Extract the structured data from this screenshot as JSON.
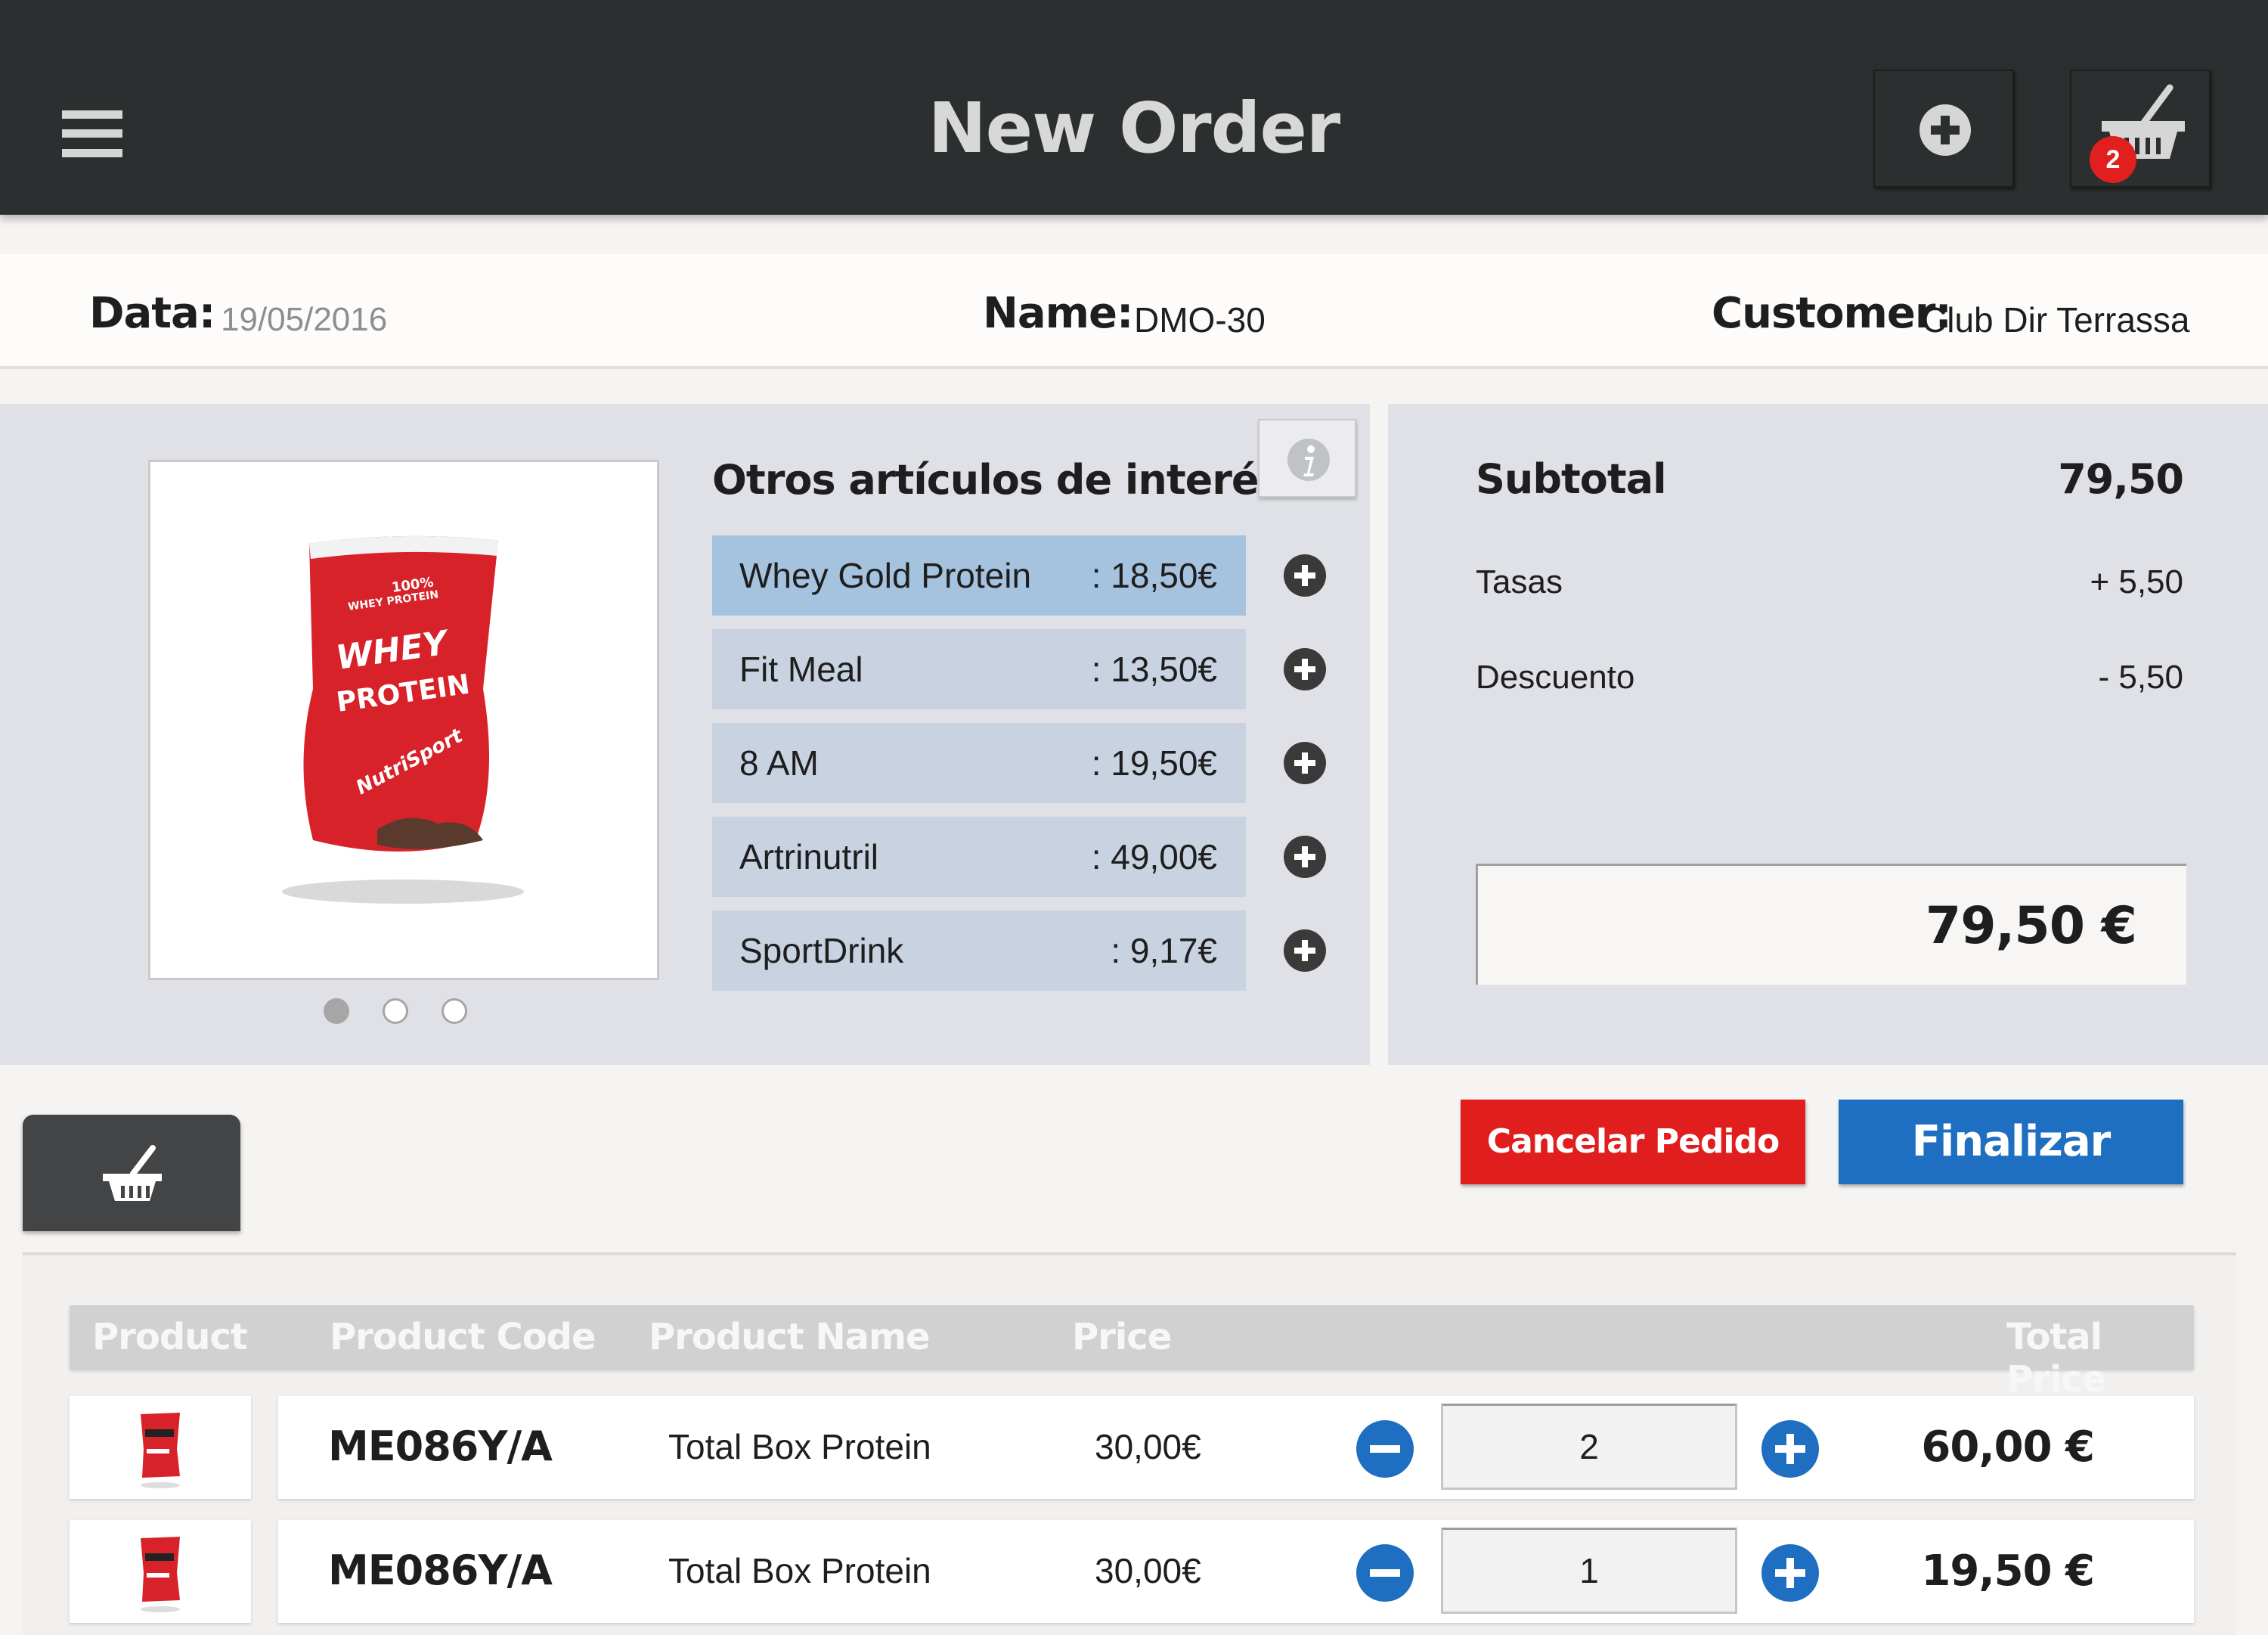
{
  "header": {
    "title": "New Order",
    "cart_count": "2"
  },
  "info": {
    "date_label": "Data:",
    "date_value": "19/05/2016",
    "name_label": "Name:",
    "name_value": "DMO-30",
    "customer_label": "Customer:",
    "customer_value": "Club Dir Terrassa"
  },
  "product": {
    "image_text": [
      "100%",
      "WHEY PROTEIN",
      "WHEY",
      "PROTEIN",
      "NutriSport"
    ],
    "carousel_pages": 3,
    "carousel_active": 1
  },
  "related": {
    "title": "Otros artículos de interés",
    "items": [
      {
        "name": "Whey Gold Protein",
        "price": ": 18,50€",
        "selected": true
      },
      {
        "name": "Fit Meal",
        "price": ": 13,50€",
        "selected": false
      },
      {
        "name": "8 AM",
        "price": ": 19,50€",
        "selected": false
      },
      {
        "name": "Artrinutril",
        "price": ": 49,00€",
        "selected": false
      },
      {
        "name": "SportDrink",
        "price": ":   9,17€",
        "selected": false
      }
    ]
  },
  "summary": {
    "subtotal_label": "Subtotal",
    "subtotal_value": "79,50",
    "taxes_label": "Tasas",
    "taxes_value": "+ 5,50",
    "discount_label": "Descuento",
    "discount_value": "- 5,50",
    "total": "79,50 €"
  },
  "actions": {
    "cancel_label": "Cancelar Pedido",
    "finalize_label": "Finalizar"
  },
  "table": {
    "headers": [
      "Product",
      "Product Code",
      "Product Name",
      "Price",
      "Total Price"
    ],
    "rows": [
      {
        "code": "ME086Y/A",
        "name": "Total Box Protein",
        "price": "30,00€",
        "qty": "2",
        "total": "60,00 €"
      },
      {
        "code": "ME086Y/A",
        "name": "Total Box Protein",
        "price": "30,00€",
        "qty": "1",
        "total": "19,50 €"
      }
    ]
  },
  "colors": {
    "topbar": "#2c2f2f",
    "cancel": "#e01e1e",
    "finalize": "#1e6fc1",
    "selected_item": "#a5c2de",
    "item": "#c8d2e0"
  },
  "icons": {
    "menu": "hamburger-menu-icon",
    "add": "plus-circle-icon",
    "cart": "basket-icon",
    "info": "info-icon",
    "minus": "minus-circle-icon"
  }
}
